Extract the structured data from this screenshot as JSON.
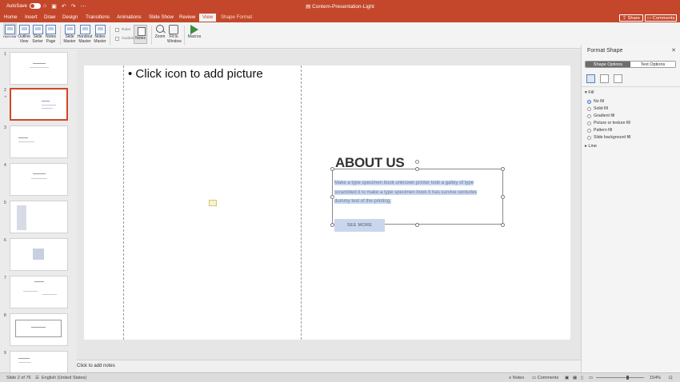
{
  "window": {
    "autosave_label": "AutoSave",
    "autosave_state": "OFF",
    "doc_title": "Contem-Presentation-Light",
    "share_label": "Share",
    "comments_label": "Comments"
  },
  "tabs": [
    "Home",
    "Insert",
    "Draw",
    "Design",
    "Transitions",
    "Animations",
    "Slide Show",
    "Review",
    "View",
    "Shape Format"
  ],
  "active_tab": "View",
  "ribbon": {
    "normal": "Normal",
    "outline": "Outline View",
    "sorter": "Slide Sorter",
    "notes_page": "Notes Page",
    "slide_master": "Slide Master",
    "handout_master": "Handout Master",
    "notes_master": "Notes Master",
    "ruler": "Ruler",
    "guides": "Guides",
    "notes": "Notes",
    "zoom": "Zoom",
    "fit": "Fit to Window",
    "macros": "Macros"
  },
  "thumbnails": [
    "1",
    "2",
    "3",
    "4",
    "5",
    "6",
    "7",
    "8",
    "9"
  ],
  "selected_slide": 2,
  "slide": {
    "placeholder_text": "• Click icon to add picture",
    "heading": "ABOUT US",
    "body": "Make a type specimen book unknown printer took a galley of type scrambled it to make a type specimen book It has survive centuries dummy text of the printing.",
    "button": "SEE MORE"
  },
  "notes_placeholder": "Click to add notes",
  "format_pane": {
    "title": "Format Shape",
    "tab_shape": "Shape Options",
    "tab_text": "Text Options",
    "fill_header": "Fill",
    "fill_options": [
      "No fill",
      "Solid fill",
      "Gradient fill",
      "Picture or texture fill",
      "Pattern fill",
      "Slide background fill"
    ],
    "selected_fill": "No fill",
    "line_header": "Line"
  },
  "status": {
    "slide_info": "Slide 2 of 76",
    "language": "English (United States)",
    "notes": "Notes",
    "comments": "Comments",
    "zoom": "154%"
  },
  "colors": {
    "accent": "#c4472b",
    "selection": "#c9d7ee"
  }
}
